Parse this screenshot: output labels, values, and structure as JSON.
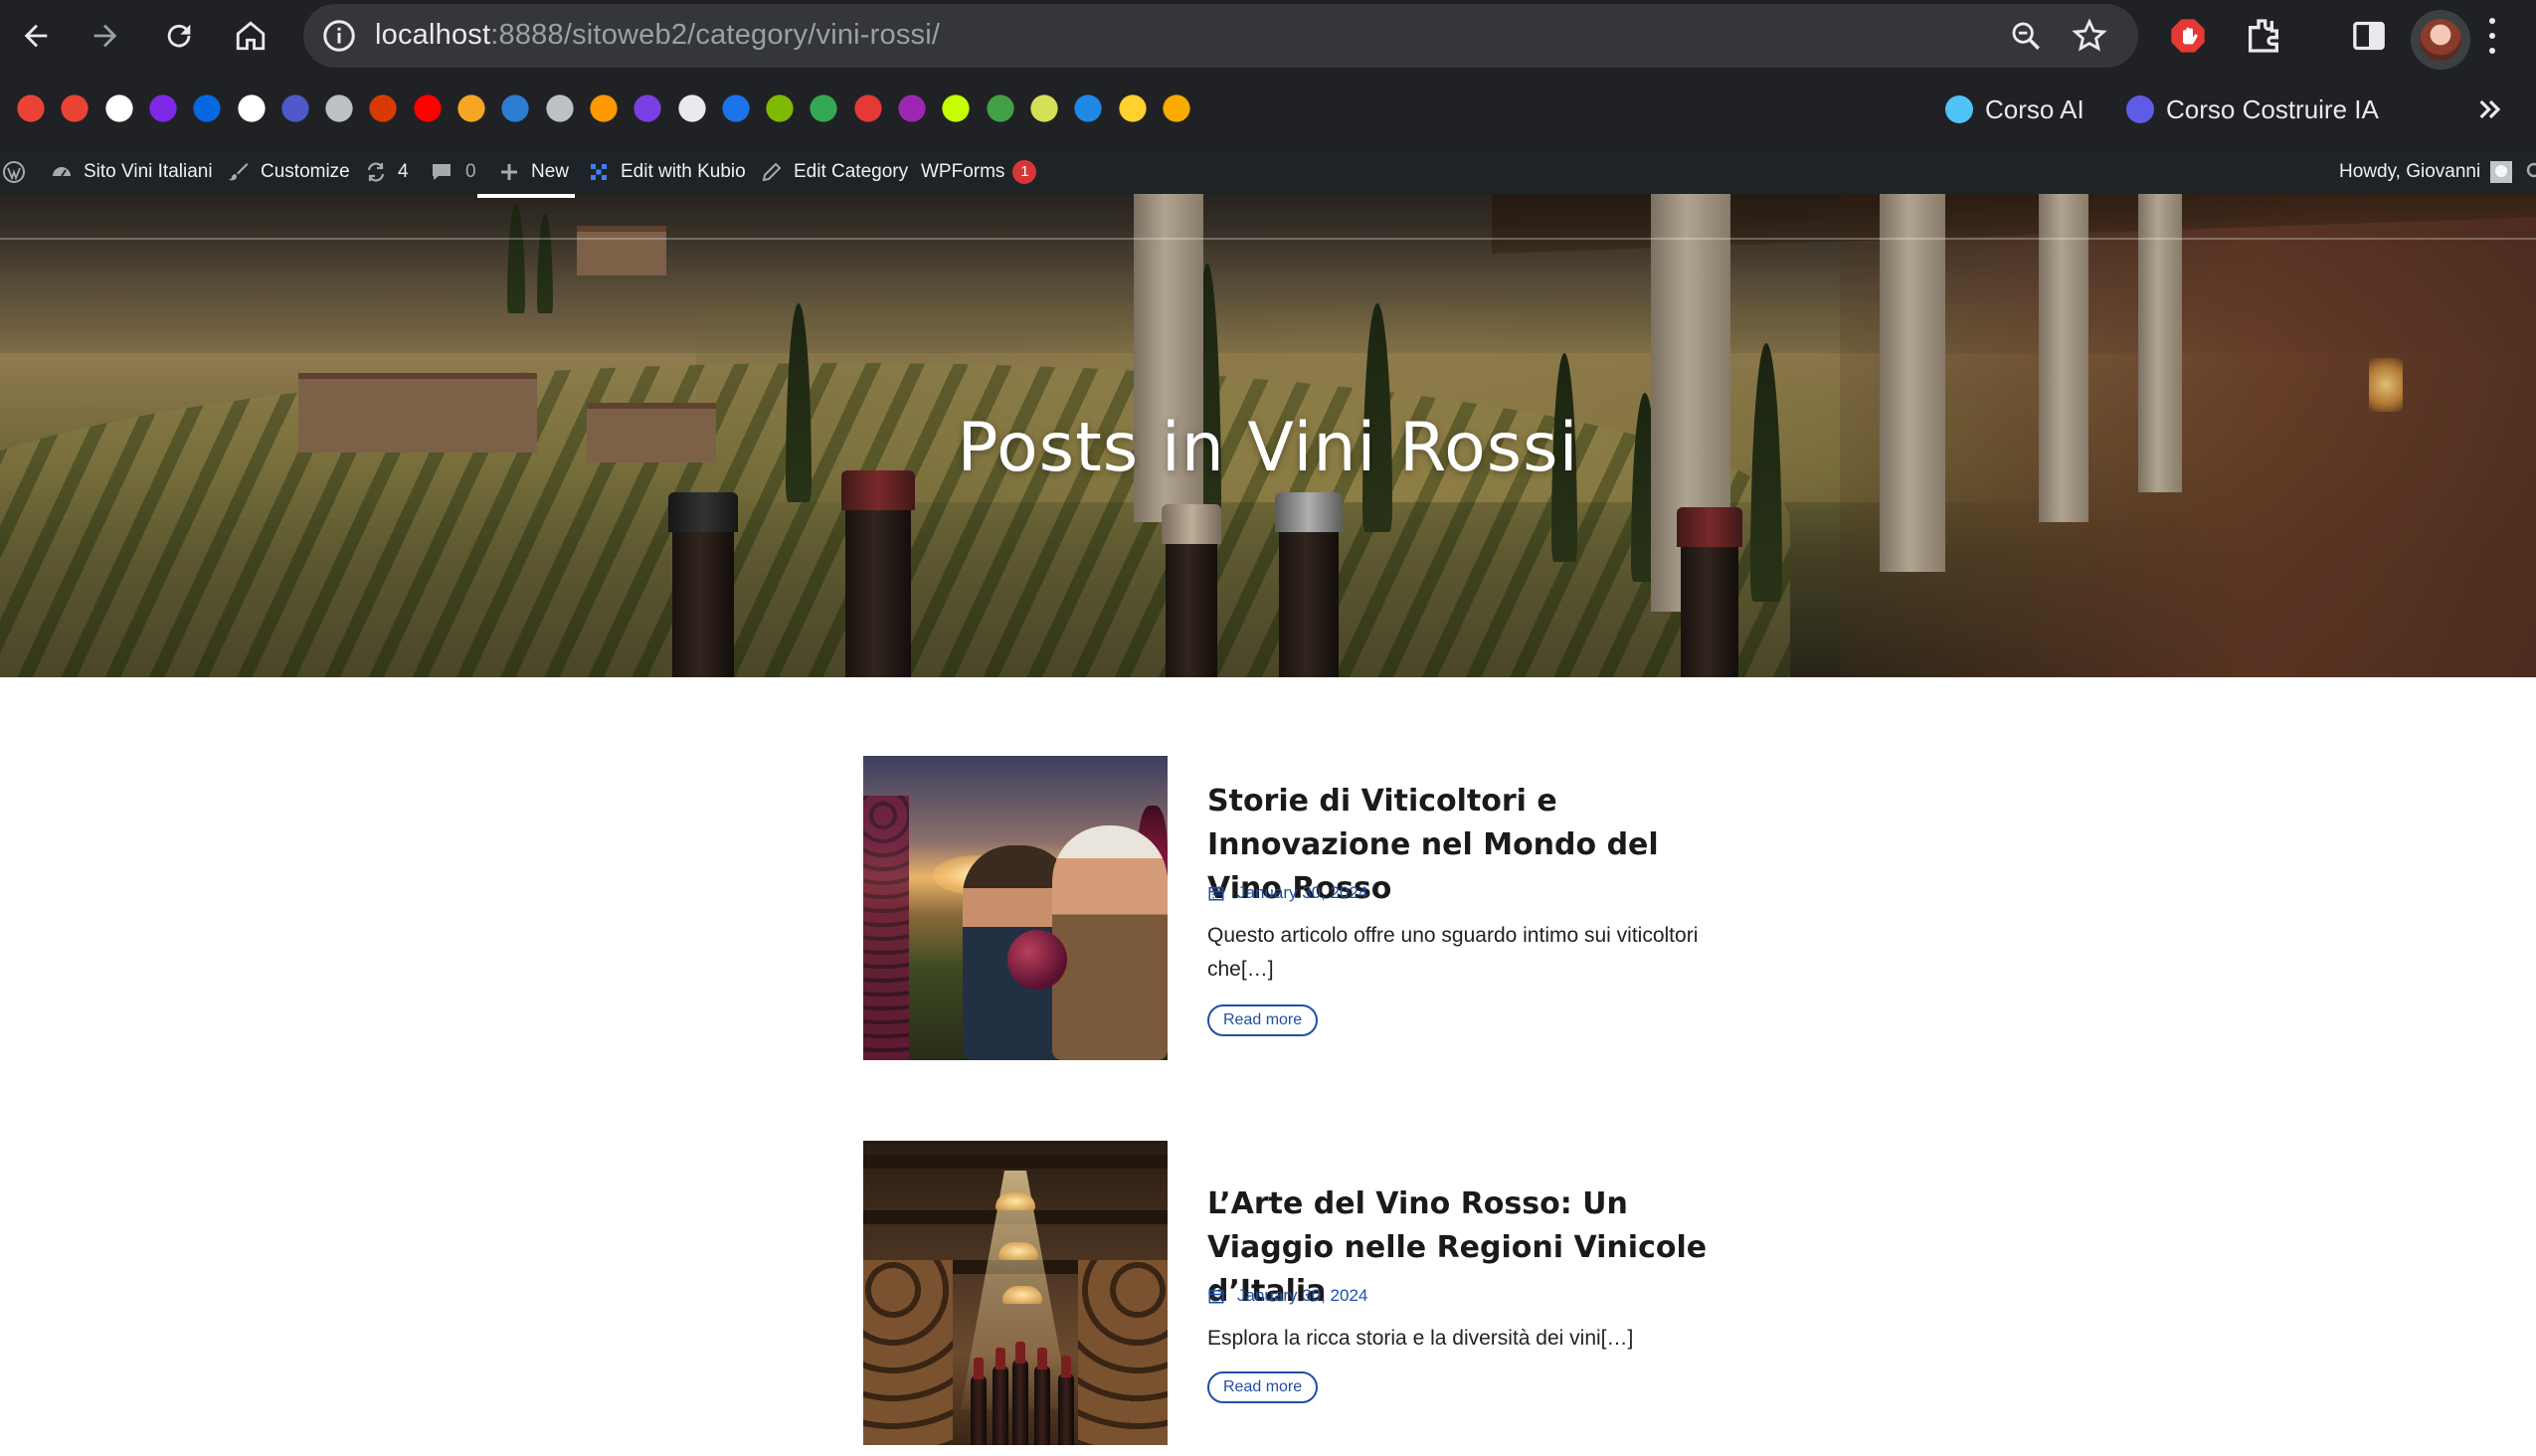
{
  "browser": {
    "url_host": "localhost",
    "url_path": ":8888/sitoweb2/category/vini-rossi/",
    "bookmarks_named": [
      {
        "label": "Corso AI",
        "color": "#4fc3f7"
      },
      {
        "label": "Corso Costruire IA",
        "color": "#5e5ce6"
      }
    ],
    "bookmark_icons": [
      {
        "name": "gmail-icon",
        "color": "#ea4335"
      },
      {
        "name": "gmail-icon",
        "color": "#ea4335"
      },
      {
        "name": "glasp-icon",
        "color": "#ffffff"
      },
      {
        "name": "canva-icon",
        "color": "#7d2ae8"
      },
      {
        "name": "meta-icon",
        "color": "#0668e1"
      },
      {
        "name": "google-icon",
        "color": "#ffffff"
      },
      {
        "name": "teams-icon",
        "color": "#5059c9"
      },
      {
        "name": "globe-icon",
        "color": "#bdc1c6"
      },
      {
        "name": "office-icon",
        "color": "#d83b01"
      },
      {
        "name": "youtube-icon",
        "color": "#ff0000"
      },
      {
        "name": "app-icon",
        "color": "#f5a623"
      },
      {
        "name": "play-icon",
        "color": "#2d7dd2"
      },
      {
        "name": "globe-icon",
        "color": "#bdc1c6"
      },
      {
        "name": "amazon-icon",
        "color": "#ff9900"
      },
      {
        "name": "app-icon",
        "color": "#7b3fe4"
      },
      {
        "name": "app-icon",
        "color": "#e8eaed"
      },
      {
        "name": "app-icon",
        "color": "#1a73e8"
      },
      {
        "name": "microsoft-icon",
        "color": "#7fba00"
      },
      {
        "name": "drive-icon",
        "color": "#34a853"
      },
      {
        "name": "app-icon",
        "color": "#e53935"
      },
      {
        "name": "app-icon",
        "color": "#9c27b0"
      },
      {
        "name": "app-icon",
        "color": "#c6ff00"
      },
      {
        "name": "chart-icon",
        "color": "#43a047"
      },
      {
        "name": "hb-icon",
        "color": "#d4e157"
      },
      {
        "name": "ef-icon",
        "color": "#1e88e5"
      },
      {
        "name": "miro-icon",
        "color": "#ffd02f"
      },
      {
        "name": "analytics-icon",
        "color": "#f9ab00"
      }
    ]
  },
  "wp_admin_bar": {
    "site_name": "Sito Vini Italiani",
    "customize": "Customize",
    "updates_count": "4",
    "comments_count": "0",
    "new": "New",
    "edit_with_kubio": "Edit with Kubio",
    "edit_category": "Edit Category",
    "wpforms": "WPForms",
    "wpforms_badge": "1",
    "howdy": "Howdy, Giovanni"
  },
  "hero": {
    "title": "Posts in Vini Rossi"
  },
  "posts": [
    {
      "title": "Storie di Viticoltori e Innovazione nel Mondo del Vino Rosso",
      "date": "January 30, 2024",
      "excerpt": "Questo articolo offre uno sguardo intimo sui viticoltori che[…]",
      "read_more": "Read more"
    },
    {
      "title": "L’Arte del Vino Rosso: Un Viaggio nelle Regioni Vinicole d’Italia",
      "date": "January 30, 2024",
      "excerpt": "Esplora la ricca storia e la diversità dei vini[…]",
      "read_more": "Read more"
    }
  ],
  "colors": {
    "accent": "#1f4fa8",
    "admin_bar": "#1d2327",
    "chrome": "#202124"
  }
}
